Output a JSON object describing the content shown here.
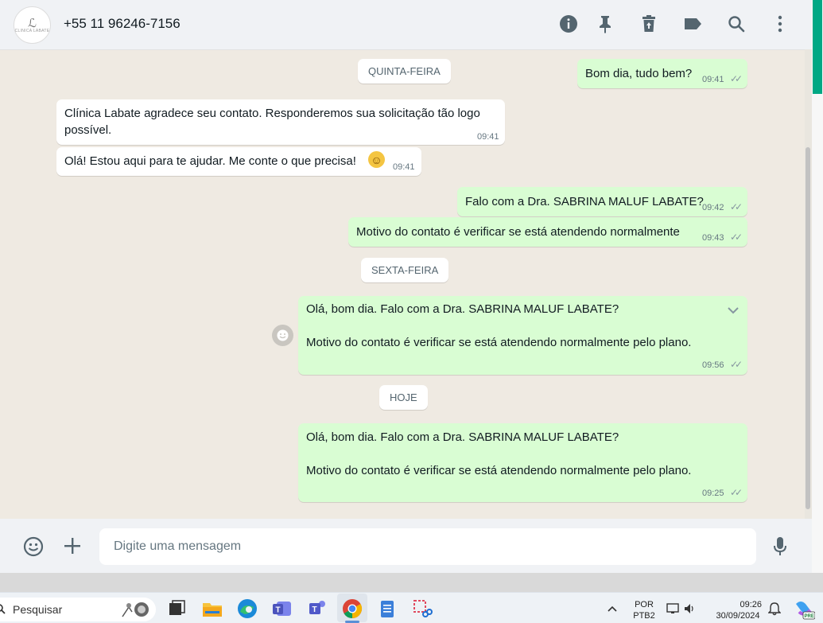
{
  "header": {
    "contact_name": "+55 11 96246-7156",
    "avatar_text": "CLINICA LABATE",
    "icons": [
      "info-icon",
      "pin-icon",
      "delete-icon",
      "label-icon",
      "search-icon",
      "menu-dots-icon"
    ]
  },
  "chat": {
    "date_chips": {
      "thursday": "QUINTA-FEIRA",
      "friday": "SEXTA-FEIRA",
      "today": "HOJE"
    },
    "messages": [
      {
        "direction": "outgoing",
        "text": "Bom dia, tudo bem?",
        "time": "09:41",
        "status": "read-ticks"
      },
      {
        "direction": "incoming",
        "text_line1": "Clínica Labate  agradece seu contato. Responderemos sua solicitação tão logo",
        "text_line2": "possível.",
        "time": "09:41"
      },
      {
        "direction": "incoming",
        "text": "Olá! Estou aqui para te ajudar. Me conte o que precisa!",
        "emoji": "☺",
        "time": "09:41"
      },
      {
        "direction": "outgoing",
        "text": "Falo com a Dra. SABRINA MALUF LABATE?",
        "time": "09:42",
        "status": "read-ticks"
      },
      {
        "direction": "outgoing",
        "text": "Motivo do contato é verificar se está atendendo normalmente",
        "time": "09:43",
        "status": "read-ticks"
      },
      {
        "direction": "outgoing",
        "text_line1": "Olá, bom dia. Falo com a Dra. SABRINA MALUF LABATE?",
        "text_line2": "Motivo do contato é verificar se está atendendo normalmente pelo plano.",
        "time": "09:56",
        "status": "read-ticks"
      },
      {
        "direction": "outgoing",
        "text_line1": "Olá, bom dia. Falo com a Dra. SABRINA MALUF LABATE?",
        "text_line2": "Motivo do contato é verificar se está atendendo normalmente pelo plano.",
        "time": "09:25",
        "status": "read-ticks"
      }
    ],
    "ticks_glyph": "✓✓"
  },
  "composer": {
    "placeholder": "Digite uma mensagem",
    "icons": [
      "emoji-icon",
      "plus-icon",
      "mic-icon"
    ]
  },
  "taskbar": {
    "search_label": "Pesquisar",
    "language_line1": "POR",
    "language_line2": "PTB2",
    "clock_time": "09:26",
    "clock_date": "30/09/2024",
    "copilot_badge": "PRE"
  },
  "colors": {
    "outgoing_bubble": "#d9fdd3",
    "incoming_bubble": "#ffffff",
    "chat_background": "#efeae2",
    "accent": "#00a884"
  }
}
